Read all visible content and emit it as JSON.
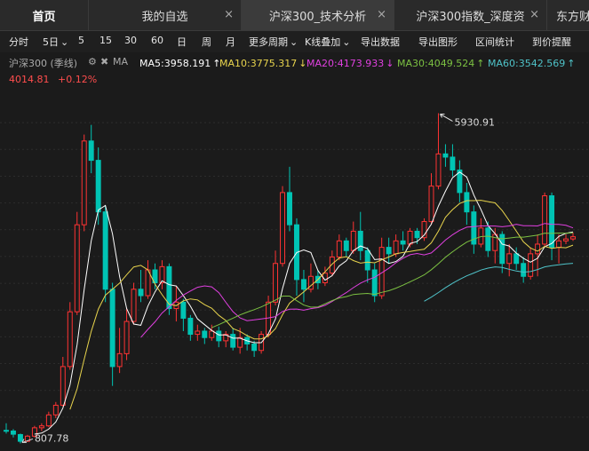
{
  "tabs": [
    {
      "label": "首页",
      "active": false,
      "closable": false
    },
    {
      "label": "我的自选",
      "active": false,
      "closable": true
    },
    {
      "label": "沪深300_技术分析",
      "active": true,
      "closable": true
    },
    {
      "label": "沪深300指数_深度资",
      "active": false,
      "closable": true
    },
    {
      "label": "东方财富",
      "active": false,
      "closable": false
    }
  ],
  "toolbar": {
    "items": [
      "分时",
      "5日",
      "5",
      "15",
      "30",
      "60",
      "日",
      "周",
      "月",
      "更多周期",
      "K线叠加",
      "导出数据",
      "导出图形",
      "区间统计",
      "到价提醒"
    ],
    "dropdown_marker": "⌄"
  },
  "info": {
    "symbol": "沪深300 (季线)",
    "ma_label": "MA",
    "ma": [
      {
        "label": "MA5:3958.191",
        "arrow": "↑",
        "color": "#ffffff"
      },
      {
        "label": "MA10:3775.317",
        "arrow": "↓",
        "color": "#e8d44d"
      },
      {
        "label": "MA20:4173.933",
        "arrow": "↓",
        "color": "#e040e0"
      },
      {
        "label": "MA30:4049.524",
        "arrow": "↑",
        "color": "#7cc142"
      },
      {
        "label": "MA60:3542.569",
        "arrow": "↑",
        "color": "#4fc3c9"
      }
    ]
  },
  "price": {
    "value": "4014.81",
    "change": "+0.12%"
  },
  "colors": {
    "up": "#ff3333",
    "down": "#00c4b4",
    "grid": "#2c2c2c"
  },
  "chart_data": {
    "type": "candlestick",
    "period": "quarterly",
    "ylim": [
      800,
      6200
    ],
    "max_annotation": {
      "value": "5930.91",
      "candle": 61
    },
    "min_annotation": {
      "value": "807.78",
      "candle": 2
    },
    "candles": [
      [
        1010,
        1000,
        1120,
        960
      ],
      [
        1000,
        950,
        1030,
        900
      ],
      [
        945,
        840,
        960,
        807.78
      ],
      [
        840,
        920,
        940,
        830
      ],
      [
        920,
        1050,
        1080,
        900
      ],
      [
        1050,
        1080,
        1120,
        1000
      ],
      [
        1080,
        1250,
        1300,
        1060
      ],
      [
        1250,
        1400,
        1450,
        1200
      ],
      [
        1400,
        2000,
        2150,
        1380
      ],
      [
        2000,
        2850,
        3000,
        1950
      ],
      [
        2850,
        4200,
        4400,
        2800
      ],
      [
        4200,
        5500,
        5600,
        4100
      ],
      [
        5500,
        5200,
        5750,
        5000
      ],
      [
        5200,
        4400,
        5400,
        4200
      ],
      [
        4400,
        3200,
        4500,
        3000
      ],
      [
        3200,
        2000,
        3300,
        1700
      ],
      [
        2000,
        2200,
        2600,
        1900
      ],
      [
        2200,
        2700,
        2900,
        2100
      ],
      [
        2700,
        3200,
        3300,
        2650
      ],
      [
        3200,
        3100,
        3500,
        3000
      ],
      [
        3100,
        3500,
        3650,
        3050
      ],
      [
        3500,
        3300,
        3600,
        3200
      ],
      [
        3300,
        3550,
        3650,
        3200
      ],
      [
        3550,
        2900,
        3600,
        2800
      ],
      [
        2900,
        3000,
        3250,
        2700
      ],
      [
        3000,
        2750,
        3050,
        2550
      ],
      [
        2750,
        2500,
        2800,
        2400
      ],
      [
        2500,
        2550,
        2650,
        2400
      ],
      [
        2550,
        2450,
        2600,
        2350
      ],
      [
        2450,
        2550,
        2650,
        2400
      ],
      [
        2550,
        2400,
        2620,
        2300
      ],
      [
        2400,
        2500,
        2550,
        2300
      ],
      [
        2500,
        2300,
        2600,
        2250
      ],
      [
        2300,
        2450,
        2600,
        2200
      ],
      [
        2450,
        2350,
        2500,
        2250
      ],
      [
        2350,
        2250,
        2400,
        2150
      ],
      [
        2250,
        2500,
        2550,
        2200
      ],
      [
        2500,
        3000,
        3100,
        2450
      ],
      [
        3000,
        3600,
        3800,
        2950
      ],
      [
        3600,
        4700,
        4800,
        3550
      ],
      [
        4700,
        4200,
        5100,
        4100
      ],
      [
        4200,
        3350,
        4300,
        3100
      ],
      [
        3350,
        3200,
        3500,
        3000
      ],
      [
        3200,
        3400,
        3600,
        3150
      ],
      [
        3400,
        3300,
        3500,
        3200
      ],
      [
        3300,
        3450,
        3550,
        3250
      ],
      [
        3450,
        3700,
        3800,
        3400
      ],
      [
        3700,
        3950,
        4050,
        3650
      ],
      [
        3950,
        3800,
        4000,
        3700
      ],
      [
        3800,
        4100,
        4250,
        3750
      ],
      [
        4100,
        3800,
        4400,
        3650
      ],
      [
        3800,
        3500,
        3850,
        3300
      ],
      [
        3500,
        3100,
        3600,
        3000
      ],
      [
        3100,
        3850,
        4000,
        3050
      ],
      [
        3850,
        3750,
        4000,
        3600
      ],
      [
        3750,
        3950,
        4050,
        3700
      ],
      [
        3950,
        3900,
        4100,
        3800
      ],
      [
        3900,
        4100,
        4150,
        3850
      ],
      [
        4100,
        4000,
        4150,
        3900
      ],
      [
        4000,
        4250,
        4300,
        3950
      ],
      [
        4250,
        4800,
        5000,
        4200
      ],
      [
        4800,
        5300,
        5930.91,
        4750
      ],
      [
        5300,
        5250,
        5450,
        5100
      ],
      [
        5250,
        5050,
        5450,
        4950
      ],
      [
        5050,
        4700,
        5200,
        4550
      ],
      [
        4700,
        4400,
        4850,
        4200
      ],
      [
        4400,
        3900,
        4500,
        3750
      ],
      [
        3900,
        4150,
        4300,
        3850
      ],
      [
        4150,
        3800,
        4250,
        3700
      ],
      [
        3800,
        4050,
        4150,
        3600
      ],
      [
        4050,
        3600,
        4100,
        3450
      ],
      [
        3600,
        3750,
        3900,
        3400
      ],
      [
        3750,
        3600,
        3850,
        3500
      ],
      [
        3600,
        3400,
        3700,
        3300
      ],
      [
        3400,
        3750,
        3850,
        3350
      ],
      [
        3750,
        3900,
        4050,
        3400
      ],
      [
        3900,
        4650,
        4700,
        3850
      ],
      [
        4650,
        3850,
        4700,
        3650
      ],
      [
        3850,
        3950,
        4050,
        3600
      ],
      [
        3950,
        3980,
        4050,
        3900
      ],
      [
        3980,
        4014.81,
        4080,
        3950
      ]
    ]
  }
}
